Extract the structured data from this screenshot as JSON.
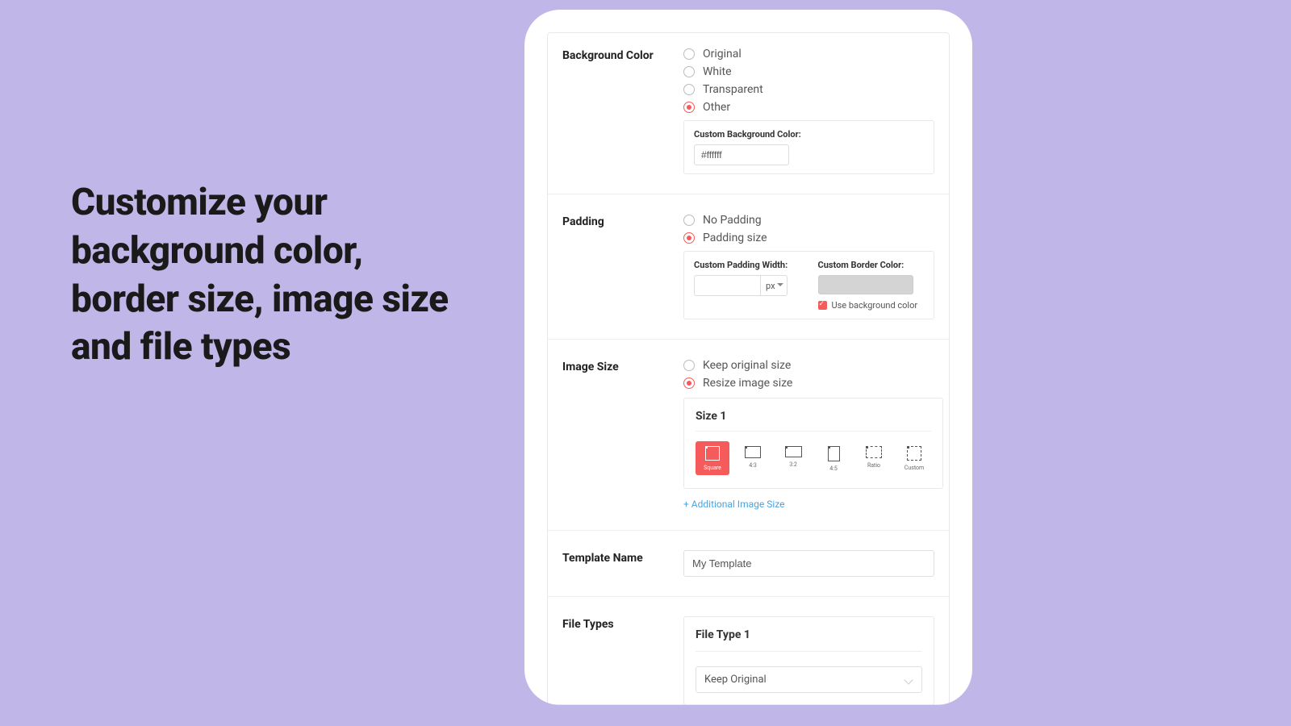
{
  "hero": "Customize your background color, border size, image size and file types",
  "bg": {
    "label": "Background Color",
    "opts": [
      "Original",
      "White",
      "Transparent",
      "Other"
    ],
    "selected": 3,
    "custom_label": "Custom Background Color:",
    "custom_value": "#ffffff"
  },
  "padding": {
    "label": "Padding",
    "opts": [
      "No Padding",
      "Padding size"
    ],
    "selected": 1,
    "width_label": "Custom Padding Width:",
    "unit": "px",
    "border_label": "Custom Border Color:",
    "use_bg_label": "Use background color"
  },
  "imgsize": {
    "label": "Image Size",
    "opts": [
      "Keep original size",
      "Resize image size"
    ],
    "selected": 1,
    "panel_title": "Size 1",
    "choices": [
      "Square",
      "4:3",
      "3:2",
      "4:5",
      "Ratio",
      "Custom"
    ],
    "sel_choice": 0,
    "add_link": "+ Additional Image Size"
  },
  "template": {
    "label": "Template Name",
    "value": "My Template"
  },
  "filetypes": {
    "label": "File Types",
    "panel_title": "File Type 1",
    "select_value": "Keep Original"
  }
}
